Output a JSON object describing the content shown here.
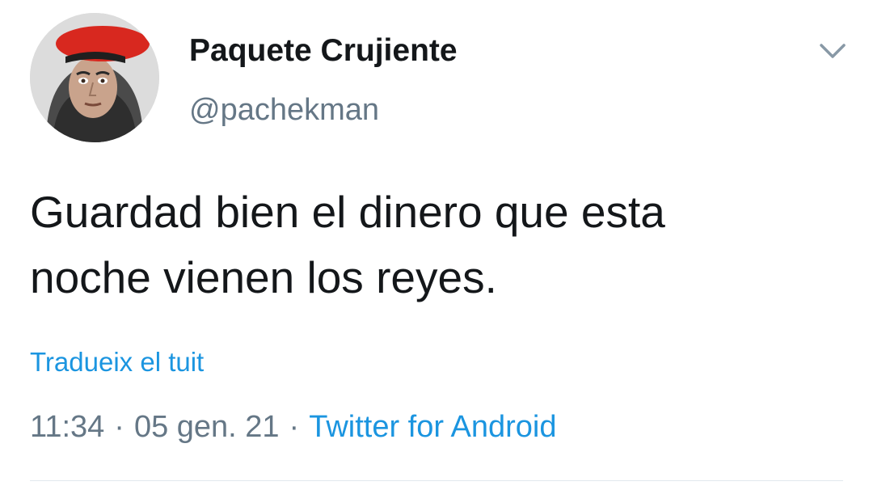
{
  "user": {
    "display_name": "Paquete Crujiente",
    "handle": "@pachekman",
    "avatar": "profile-photo"
  },
  "tweet": {
    "line1": "Guardad bien el dinero que esta",
    "line2": "noche vienen los reyes."
  },
  "translate_label": "Tradueix el tuit",
  "meta": {
    "time": "11:34",
    "separator": "·",
    "date": "05 gen. 21",
    "source": "Twitter for Android"
  },
  "icons": {
    "menu": "chevron-down-icon"
  },
  "colors": {
    "text": "#14171a",
    "secondary": "#657786",
    "link": "#1b95e0",
    "divider": "#e1e8ed"
  }
}
